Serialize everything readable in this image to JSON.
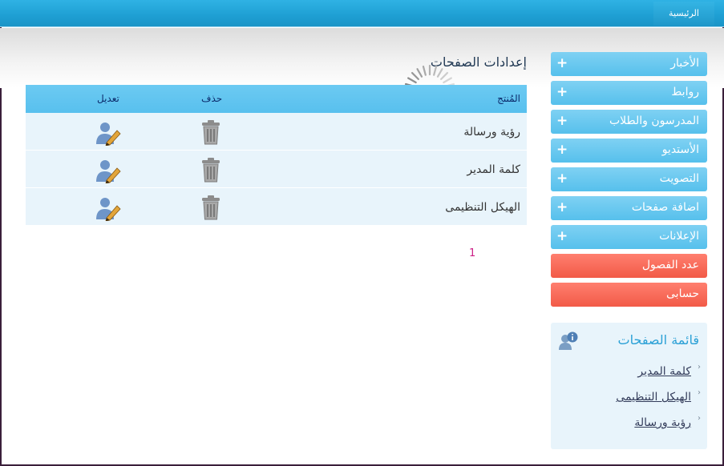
{
  "topnav": {
    "home_label": "الرئيسية"
  },
  "sidebar": {
    "menu": [
      {
        "label": "الأخبار",
        "icon": "+",
        "color": "#56c0ec"
      },
      {
        "label": "روابط",
        "icon": "+",
        "color": "#56c0ec"
      },
      {
        "label": "المدرسون والطلاب",
        "icon": "+",
        "color": "#56c0ec"
      },
      {
        "label": "الأستديو",
        "icon": "+",
        "color": "#56c0ec"
      },
      {
        "label": "التصويت",
        "icon": "+",
        "color": "#56c0ec"
      },
      {
        "label": "اضافة صفحات",
        "icon": "+",
        "color": "#56c0ec"
      },
      {
        "label": "الإعلانات",
        "icon": "+",
        "color": "#56c0ec"
      },
      {
        "label": "عدد الفصول",
        "color": "#f25a47"
      },
      {
        "label": "حسابى",
        "color": "#f25a47"
      }
    ],
    "pages_box": {
      "title": "قائمة الصفحات",
      "icon": "user-info-icon",
      "links": [
        "كلمة المدير",
        "الهيكل التنظيمى",
        "رؤية ورسالة"
      ]
    }
  },
  "main": {
    "title": "إعدادات الصفحات",
    "table": {
      "headers": {
        "product": "المُنتج",
        "delete": "حذف",
        "edit": "تعديل"
      },
      "rows": [
        {
          "name": "رؤية ورسالة",
          "delete_icon": "trash-icon",
          "edit_icon": "user-edit-icon"
        },
        {
          "name": "كلمة المدير",
          "delete_icon": "trash-icon",
          "edit_icon": "user-edit-icon"
        },
        {
          "name": "الهيكل التنظيمى",
          "delete_icon": "trash-icon",
          "edit_icon": "user-edit-icon"
        }
      ]
    },
    "pagination": {
      "current": "1"
    }
  },
  "colors": {
    "accent": "#56c0ec",
    "danger": "#f25a47",
    "header": "#1e9fd3",
    "link_active": "#cc1f86"
  }
}
